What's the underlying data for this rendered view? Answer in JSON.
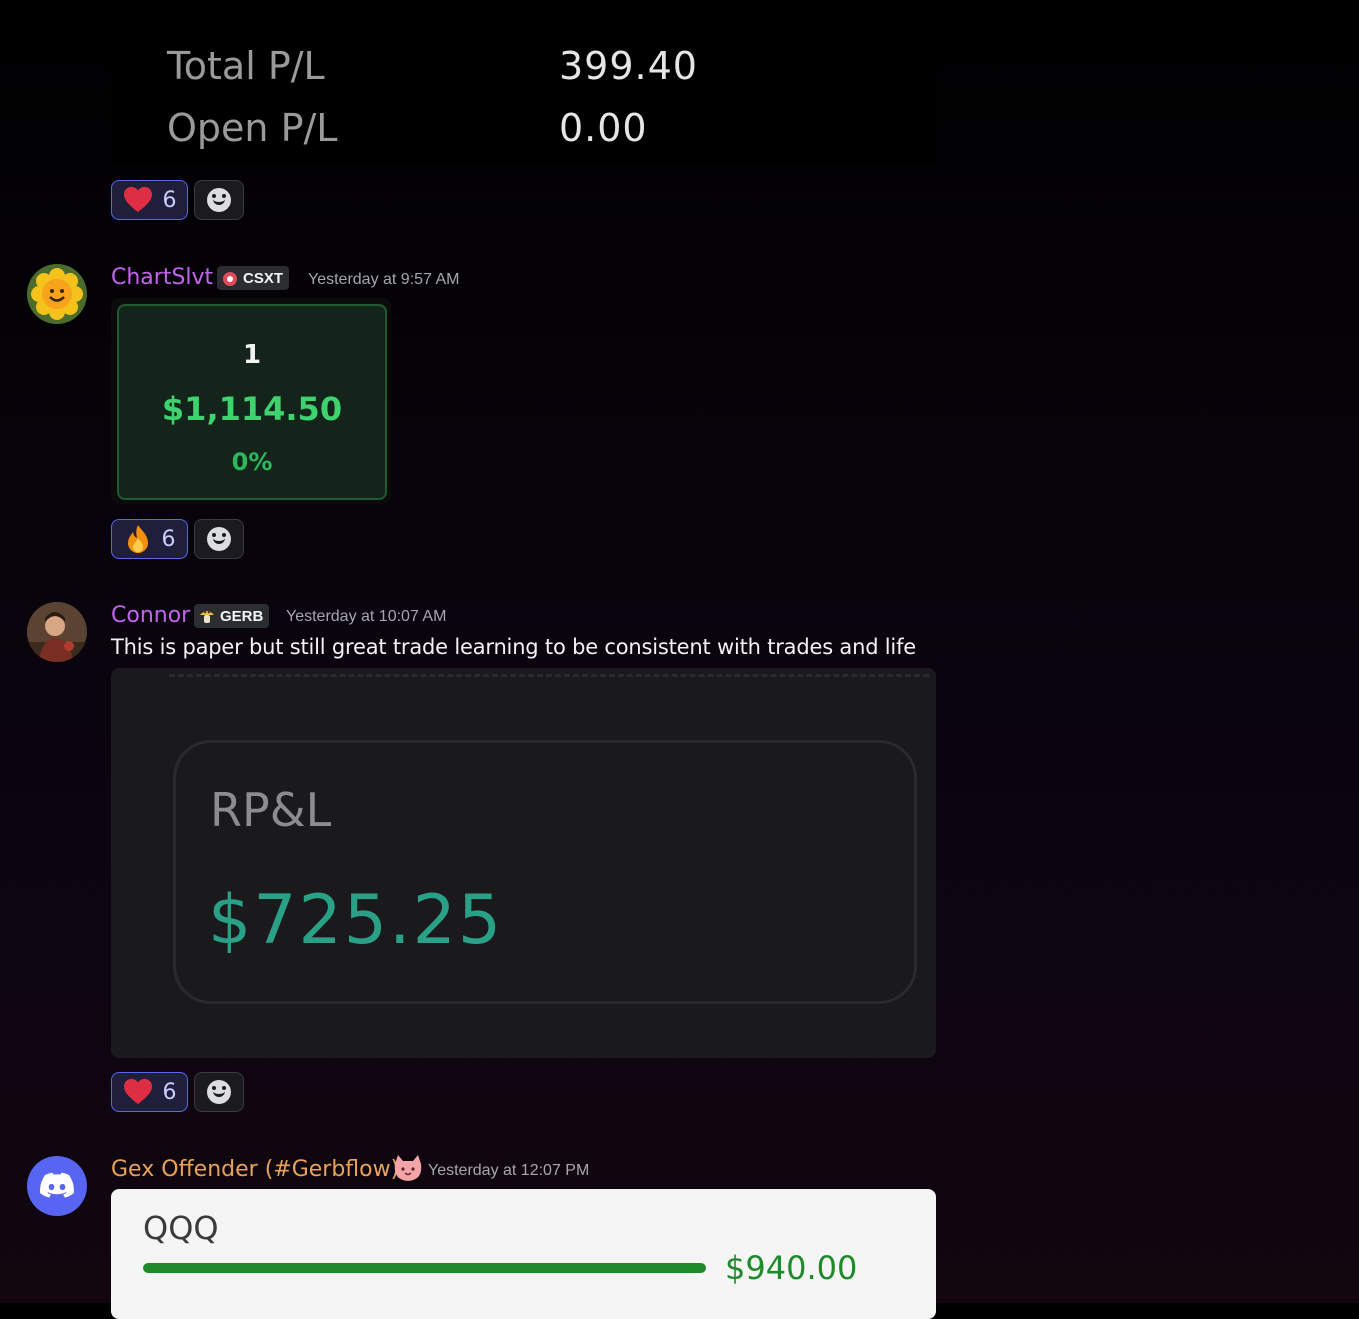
{
  "pl_card": {
    "total_label": "Total P/L",
    "total_value": "399.40",
    "open_label": "Open P/L",
    "open_value": "0.00"
  },
  "messages": [
    {
      "reaction": {
        "emoji": "heart-icon",
        "count": "6"
      }
    },
    {
      "username": "ChartSlvt",
      "username_color": "#c264f0",
      "tag": "CSXT",
      "timestamp": "Yesterday at 9:57 AM",
      "card": {
        "rank": "1",
        "amount": "$1,114.50",
        "percent": "0%"
      },
      "reaction": {
        "emoji": "fire-icon",
        "count": "6"
      }
    },
    {
      "username": "Connor",
      "username_color": "#c264f0",
      "tag": "GERB",
      "timestamp": "Yesterday at 10:07 AM",
      "text": "This is paper but still great trade learning to be consistent  with trades and life",
      "image": {
        "label": "RP&L",
        "value": "$725.25"
      },
      "reaction": {
        "emoji": "heart-icon",
        "count": "6"
      }
    },
    {
      "username": "Gex Offender  (#Gerbflow)",
      "username_color": "#e8a35a",
      "timestamp": "Yesterday at 12:07 PM",
      "card": {
        "ticker": "QQQ",
        "value": "$940.00"
      }
    }
  ],
  "colors": {
    "reaction_border": "#5865f2",
    "positive_green": "#3ed36e",
    "discord_blurple": "#5865f2"
  }
}
